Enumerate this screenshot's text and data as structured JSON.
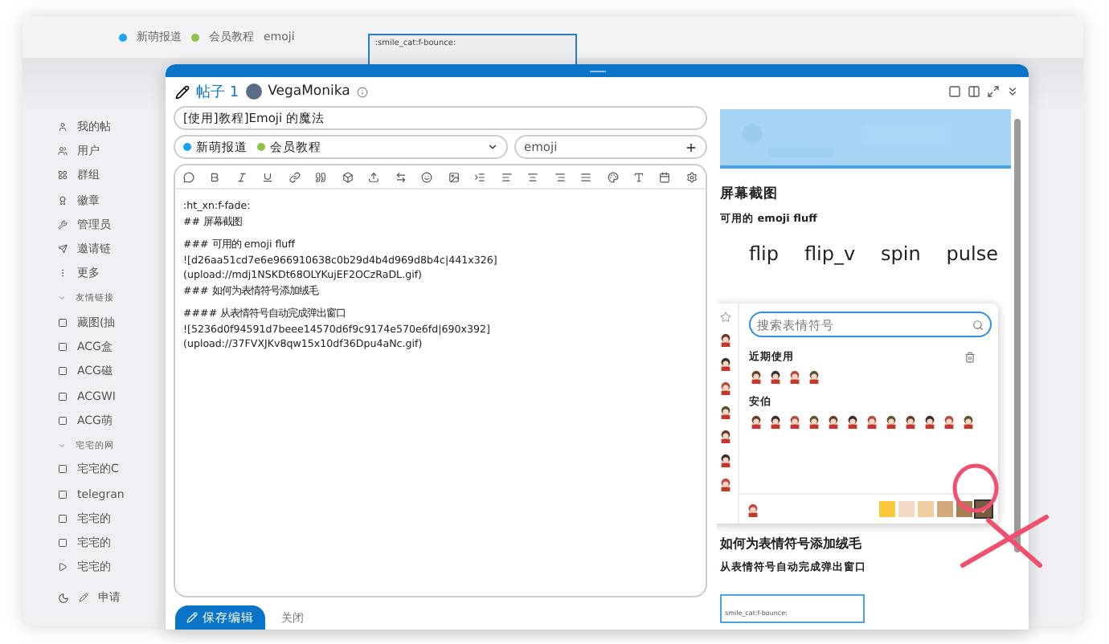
{
  "background": {
    "header_tags": [
      {
        "label": "新萌报道",
        "color": "#1da1f2"
      },
      {
        "label": "会员教程",
        "color": "#8bc34a"
      }
    ],
    "header_tag_text": "emoji",
    "thumbnail_text": ":smile_cat:f-bounce:",
    "sidebar": {
      "items": [
        "我的帖",
        "用户",
        "群组",
        "徽章",
        "管理员",
        "邀请链",
        "更多"
      ],
      "sections": [
        {
          "title": "友情链接",
          "items": [
            "藏图(抽",
            "ACG盒",
            "ACG磁",
            "ACGWI",
            "ACG萌"
          ]
        },
        {
          "title": "宅宅的网",
          "items": [
            "宅宅的C",
            "telegran",
            "宅宅的",
            "宅宅的",
            "宅宅的"
          ]
        }
      ],
      "footer": "申请"
    }
  },
  "composer": {
    "post_label": "帖子 1",
    "username": "VegaMonika",
    "title": "[使用]教程]Emoji 的魔法",
    "categories": [
      {
        "label": "新萌报道",
        "color": "#1da1f2"
      },
      {
        "label": "会员教程",
        "color": "#8bc34a"
      }
    ],
    "tag": "emoji",
    "editor": [
      [
        ":ht_xn:f-fade:",
        "## 屏幕截图"
      ],
      [
        "### 可用的 emoji fluff",
        "![d26aa51cd7e6e966910638c0b29d4b4d969d8b4c|441x326]",
        "(upload://mdj1NSKDt68OLYKujEF2OCzRaDL.gif)",
        "### 如何为表情符号添加绒毛"
      ],
      [
        "#### 从表情符号自动完成弹出窗口",
        "![5236d0f94591d7beee14570d6f9c9174e570e6fd|690x392]",
        "(upload://37FVXJKv8qw15x10df36Dpu4aNc.gif)"
      ]
    ],
    "save_button": "保存编辑",
    "close_link": "关闭"
  },
  "preview": {
    "heading": "屏幕截图",
    "subheading": "可用的 emoji fluff",
    "effects": [
      "flip",
      "flip_v",
      "spin",
      "pulse"
    ],
    "heading2": "如何为表情符号添加绒毛",
    "subheading2": "从表情符号自动完成弹出窗口",
    "thumb_text": "smile_cat:f-bounce:"
  },
  "emoji_picker": {
    "search": {
      "placeholder": "搜索表情符号"
    },
    "sections": [
      {
        "title": "近期使用",
        "clearable": true
      },
      {
        "title": "安伯",
        "clearable": false
      }
    ],
    "skin_tones": [
      {
        "color": "#f8c93c",
        "selected": false
      },
      {
        "color": "#f4d9c6",
        "selected": false
      },
      {
        "color": "#efcf9f",
        "selected": false
      },
      {
        "color": "#d3a67c",
        "selected": false
      },
      {
        "color": "#a97c55",
        "selected": false
      },
      {
        "color": "#7a5a40",
        "selected": true
      }
    ]
  }
}
